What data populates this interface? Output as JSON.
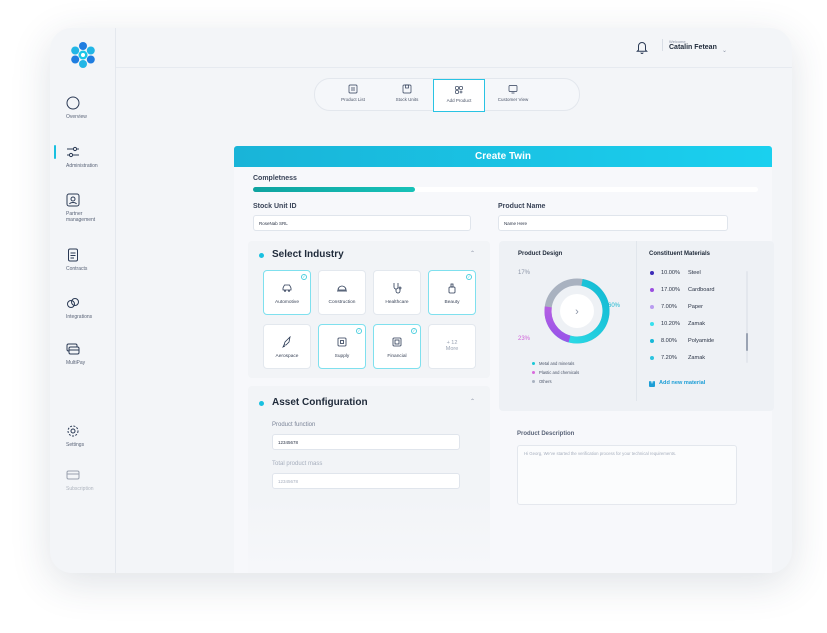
{
  "user": {
    "welcome": "Welcome",
    "name": "Catalin Fetean"
  },
  "sidebar": {
    "items": [
      {
        "label": "Overview",
        "icon": "circle-icon"
      },
      {
        "label": "Administration",
        "icon": "sliders-icon"
      },
      {
        "label": "Partner management",
        "icon": "contact-card-icon"
      },
      {
        "label": "Contracts",
        "icon": "document-icon"
      },
      {
        "label": "Integrations",
        "icon": "link-icon"
      },
      {
        "label": "MultiPay",
        "icon": "cards-icon"
      },
      {
        "label": "Settings",
        "icon": "gear-icon"
      },
      {
        "label": "Subscription",
        "icon": "credit-card-icon"
      }
    ]
  },
  "navtabs": [
    {
      "label": "Product List"
    },
    {
      "label": "Stock Units"
    },
    {
      "label": "Add Product"
    },
    {
      "label": "Customer View"
    }
  ],
  "form": {
    "header": "Create Twin",
    "completeness_label": "Completness",
    "completeness_fraction": 0.32,
    "stock_label": "Stock Unit ID",
    "stock_value": "RoseNab SRL",
    "product_name_label": "Product Name",
    "product_name_value": "Name Here"
  },
  "industry": {
    "title": "Select Industry",
    "tiles": [
      {
        "label": "Automotive",
        "selected": true
      },
      {
        "label": "Construction",
        "selected": false
      },
      {
        "label": "Healthcare",
        "selected": false
      },
      {
        "label": "Beauty",
        "selected": true
      },
      {
        "label": "Aerospace",
        "selected": false
      },
      {
        "label": "Supply",
        "selected": true
      },
      {
        "label": "Financial",
        "selected": true
      }
    ],
    "more_line1": "+ 12",
    "more_line2": "More"
  },
  "design": {
    "title": "Product Design",
    "pct_top": "17%",
    "pct_right": "60%",
    "pct_bottom": "23%",
    "legend": [
      {
        "label": "Metal and minerals",
        "color": "#19c7d6"
      },
      {
        "label": "Plastic and chemicals",
        "color": "#d86bdc"
      },
      {
        "label": "Others",
        "color": "#a9b2c0"
      }
    ]
  },
  "materials": {
    "title": "Constituent Materials",
    "items": [
      {
        "pct": "10.00%",
        "name": "Steel",
        "color": "#3d2cb8"
      },
      {
        "pct": "17.00%",
        "name": "Cardboard",
        "color": "#9b4fe0"
      },
      {
        "pct": "7.00%",
        "name": "Paper",
        "color": "#b99cf0"
      },
      {
        "pct": "10.20%",
        "name": "Zamak",
        "color": "#38e0ee"
      },
      {
        "pct": "8.00%",
        "name": "Polyamide",
        "color": "#16b8d8"
      },
      {
        "pct": "7.20%",
        "name": "Zamak",
        "color": "#2cc4df"
      }
    ],
    "add_label": "Add new material"
  },
  "asset": {
    "title": "Asset Configuration",
    "function_label": "Product function",
    "function_value": "12345678",
    "mass_label": "Total product mass",
    "mass_value": "12345678"
  },
  "description": {
    "title": "Product Description",
    "text": "Hi Georg, We've started the verification process for your technical requirements."
  },
  "colors": {
    "accent": "#19c0e0",
    "progress": "#12aeab"
  }
}
